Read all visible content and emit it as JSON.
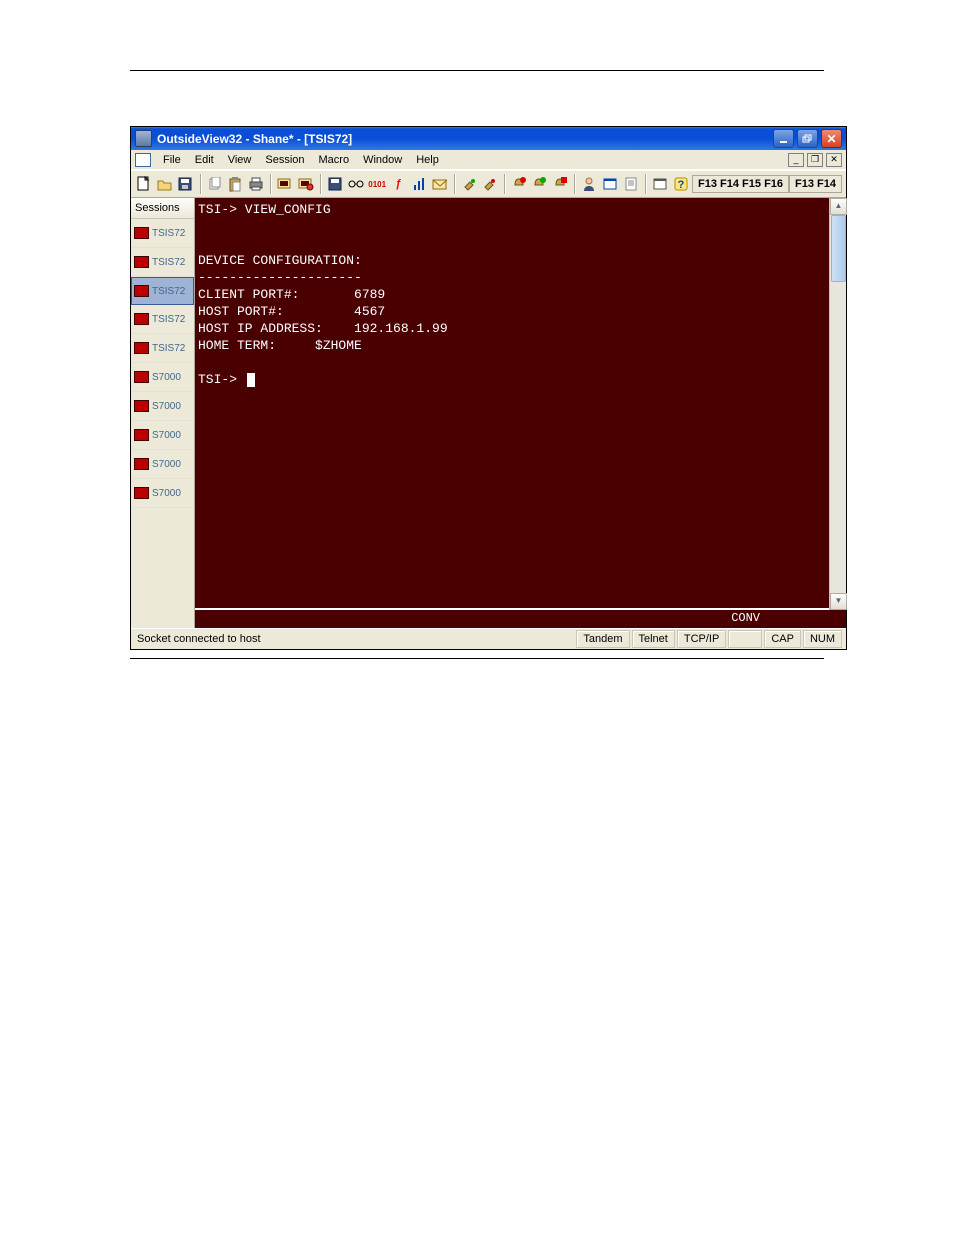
{
  "window": {
    "title": "OutsideView32 - Shane* - [TSIS72]"
  },
  "menu": {
    "file": "File",
    "edit": "Edit",
    "view": "View",
    "session": "Session",
    "macro": "Macro",
    "window": "Window",
    "help": "Help"
  },
  "fkeys": {
    "group1": "F13 F14 F15 F16",
    "group2": "F13 F14"
  },
  "sidebar": {
    "header": "Sessions",
    "items": [
      {
        "label": "TSIS72",
        "active": false,
        "variant": "tsi"
      },
      {
        "label": "TSIS72",
        "active": false,
        "variant": "tsi"
      },
      {
        "label": "TSIS72",
        "active": true,
        "variant": "tsi"
      },
      {
        "label": "TSIS72",
        "active": false,
        "variant": "tsi"
      },
      {
        "label": "TSIS72",
        "active": false,
        "variant": "tsi"
      },
      {
        "label": "S7000",
        "active": false,
        "variant": "s7"
      },
      {
        "label": "S7000",
        "active": false,
        "variant": "s7"
      },
      {
        "label": "S7000",
        "active": false,
        "variant": "s7"
      },
      {
        "label": "S7000",
        "active": false,
        "variant": "s7"
      },
      {
        "label": "S7000",
        "active": false,
        "variant": "s7"
      }
    ]
  },
  "terminal": {
    "line1": "TSI-> VIEW_CONFIG",
    "blank1": "",
    "blank2": "",
    "line2": "DEVICE CONFIGURATION:",
    "rule": "---------------------",
    "line3": "CLIENT PORT#:       6789",
    "line4": "HOST PORT#:         4567",
    "line5": "HOST IP ADDRESS:    192.168.1.99",
    "line6": "HOME TERM:     $ZHOME",
    "blank3": "",
    "prompt": "TSI-> ",
    "conv": "CONV"
  },
  "config_values": {
    "client_port": 6789,
    "host_port": 4567,
    "host_ip_address": "192.168.1.99",
    "home_term": "$ZHOME"
  },
  "statusbar": {
    "msg": "Socket connected to host",
    "emul": "Tandem",
    "proto": "Telnet",
    "net": "TCP/IP",
    "cap": "CAP",
    "num": "NUM"
  }
}
